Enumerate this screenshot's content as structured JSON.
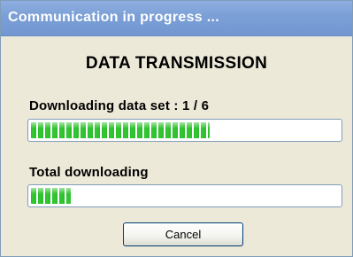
{
  "window": {
    "title": "Communication in progress ..."
  },
  "main": {
    "heading": "DATA TRANSMISSION",
    "download_label": "Downloading data set : 1 / 6",
    "download_progress": 0.58,
    "total_label": "Total downloading",
    "total_progress": 0.13
  },
  "buttons": {
    "cancel_label": "Cancel"
  },
  "colors": {
    "title_bar": "#7b9fd6",
    "dialog_background": "#ece9d8",
    "progress_green": "#2bbb2b"
  }
}
